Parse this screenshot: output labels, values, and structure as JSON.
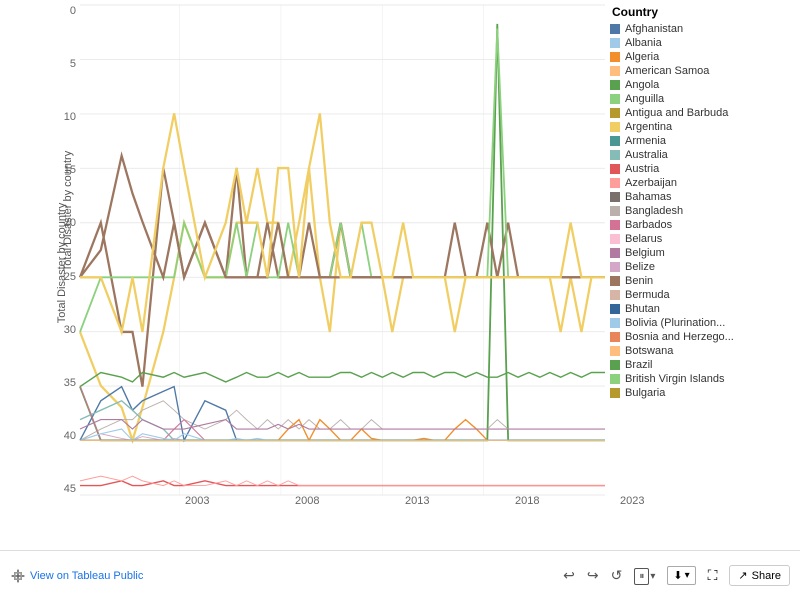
{
  "legend": {
    "title": "Country",
    "items": [
      {
        "label": "Afghanistan",
        "color": "#4e79a7",
        "shape": "square"
      },
      {
        "label": "Albania",
        "color": "#a0cbe8",
        "shape": "square"
      },
      {
        "label": "Algeria",
        "color": "#f28e2b",
        "shape": "square"
      },
      {
        "label": "American Samoa",
        "color": "#ffbe7d",
        "shape": "square"
      },
      {
        "label": "Angola",
        "color": "#59a14f",
        "shape": "square"
      },
      {
        "label": "Anguilla",
        "color": "#8cd17d",
        "shape": "square"
      },
      {
        "label": "Antigua and Barbuda",
        "color": "#b6992d",
        "shape": "square"
      },
      {
        "label": "Argentina",
        "color": "#f1ce63",
        "shape": "square"
      },
      {
        "label": "Armenia",
        "color": "#499894",
        "shape": "square"
      },
      {
        "label": "Australia",
        "color": "#86bcb6",
        "shape": "square"
      },
      {
        "label": "Austria",
        "color": "#e15759",
        "shape": "square"
      },
      {
        "label": "Azerbaijan",
        "color": "#ff9d9a",
        "shape": "square"
      },
      {
        "label": "Bahamas",
        "color": "#79706e",
        "shape": "square"
      },
      {
        "label": "Bangladesh",
        "color": "#bab0ac",
        "shape": "square"
      },
      {
        "label": "Barbados",
        "color": "#d37295",
        "shape": "square"
      },
      {
        "label": "Belarus",
        "color": "#fabfd2",
        "shape": "square"
      },
      {
        "label": "Belgium",
        "color": "#b07aa1",
        "shape": "square"
      },
      {
        "label": "Belize",
        "color": "#d4a6c8",
        "shape": "square"
      },
      {
        "label": "Benin",
        "color": "#9d7660",
        "shape": "square"
      },
      {
        "label": "Bermuda",
        "color": "#d7b5a6",
        "shape": "square"
      },
      {
        "label": "Bhutan",
        "color": "#4e79a7",
        "shape": "square"
      },
      {
        "label": "Bolivia (Plurination...",
        "color": "#a0cbe8",
        "shape": "square"
      },
      {
        "label": "Bosnia and Herzego...",
        "color": "#f28e2b",
        "shape": "square"
      },
      {
        "label": "Botswana",
        "color": "#ffbe7d",
        "shape": "square"
      },
      {
        "label": "Brazil",
        "color": "#59a14f",
        "shape": "square"
      },
      {
        "label": "British Virgin Islands",
        "color": "#8cd17d",
        "shape": "square"
      },
      {
        "label": "Bulgaria",
        "color": "#b6992d",
        "shape": "square"
      }
    ]
  },
  "chart": {
    "title": "",
    "y_axis_label": "Total Disaster by country",
    "y_ticks": [
      "0",
      "5",
      "10",
      "15",
      "20",
      "25",
      "30",
      "35",
      "40",
      "45"
    ],
    "x_ticks": [
      "2003",
      "2008",
      "2013",
      "2018",
      "2023"
    ]
  },
  "footer": {
    "tableau_label": "View on Tableau Public",
    "undo_icon": "↩",
    "redo_icon": "↪",
    "revert_icon": "↺",
    "pause_icon": "⏸",
    "download_icon": "⬇",
    "fullscreen_icon": "⛶",
    "share_label": "Share"
  }
}
